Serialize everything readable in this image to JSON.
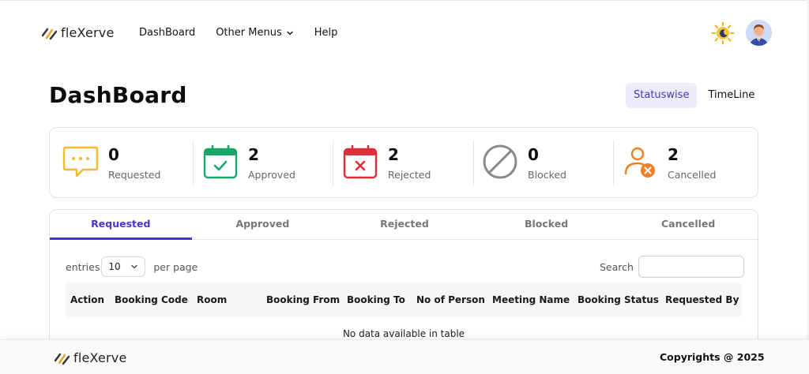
{
  "brand": {
    "name": "fleXerve"
  },
  "nav": {
    "links": [
      {
        "label": "DashBoard"
      },
      {
        "label": "Other Menus"
      },
      {
        "label": "Help"
      }
    ]
  },
  "header": {
    "title": "DashBoard",
    "views": [
      {
        "label": "Statuswise",
        "active": true
      },
      {
        "label": "TimeLine",
        "active": false
      }
    ]
  },
  "stats": [
    {
      "count": "0",
      "label": "Requested",
      "icon": "chat-bubble-icon",
      "color": "#f5b82e"
    },
    {
      "count": "2",
      "label": "Approved",
      "icon": "calendar-check-icon",
      "color": "#1aa66a"
    },
    {
      "count": "2",
      "label": "Rejected",
      "icon": "calendar-x-icon",
      "color": "#d9313b"
    },
    {
      "count": "0",
      "label": "Blocked",
      "icon": "blocked-icon",
      "color": "#8a8a8a"
    },
    {
      "count": "2",
      "label": "Cancelled",
      "icon": "user-cancel-icon",
      "color": "#f07e22"
    }
  ],
  "tabs": [
    {
      "label": "Requested",
      "active": true
    },
    {
      "label": "Approved",
      "active": false
    },
    {
      "label": "Rejected",
      "active": false
    },
    {
      "label": "Blocked",
      "active": false
    },
    {
      "label": "Cancelled",
      "active": false
    }
  ],
  "table": {
    "entries_label": "entries",
    "entries_value": "10",
    "per_page_label": "per page",
    "search_label": "Search",
    "search_placeholder": "",
    "columns": [
      "Action",
      "Booking Code",
      "Room",
      "Booking From",
      "Booking To",
      "No of Person",
      "Meeting Name",
      "Booking Status",
      "Requested By"
    ],
    "empty_text": "No data available in table"
  },
  "footer": {
    "brand": "fleXerve",
    "copyright": "Copyrights @ 2025"
  },
  "colors": {
    "accent": "#4338ca",
    "accent_bg": "#ececfb"
  }
}
